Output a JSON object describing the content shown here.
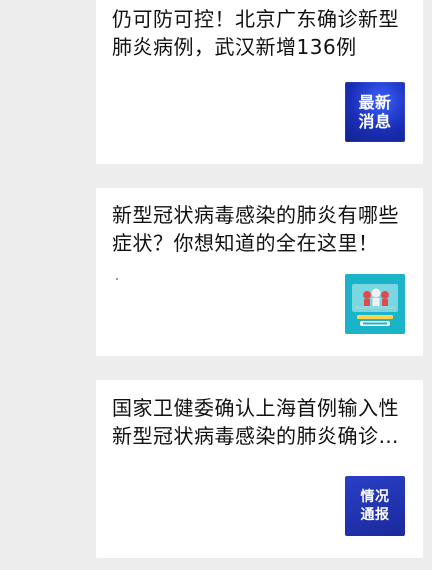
{
  "feed": {
    "articles": [
      {
        "title": "仍可防可控！北京广东确诊新型肺炎病例，武汉新增136例",
        "thumbnail": {
          "text": "最新\n消息",
          "style": "blue-gradient",
          "colors": {
            "start": "#3a60ff",
            "end": "#12208c"
          }
        }
      },
      {
        "title": "新型冠状病毒感染的肺炎有哪些症状？你想知道的全在这里！",
        "thumbnail": {
          "text": "",
          "style": "infographic",
          "colors": {
            "background": "#1bb3c7",
            "accent": "#e14b4b"
          }
        }
      },
      {
        "title": "国家卫健委确认上海首例输入性新型冠状病毒感染的肺炎确诊病例",
        "thumbnail": {
          "text": "情况\n通报",
          "style": "blue-solid",
          "colors": {
            "start": "#2a3fc7",
            "end": "#1a2a9b"
          }
        }
      }
    ]
  }
}
